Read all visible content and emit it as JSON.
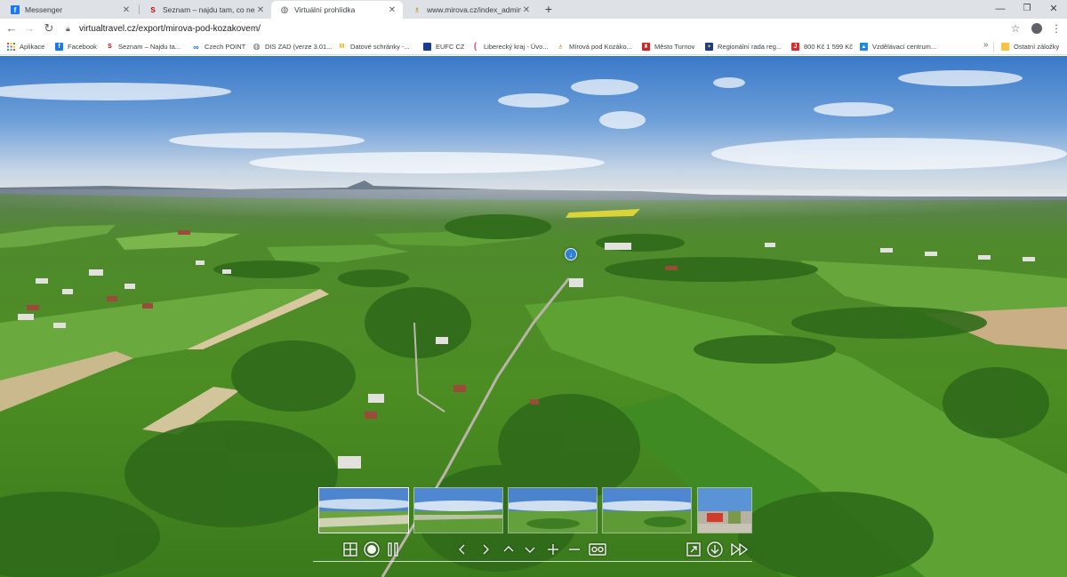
{
  "browser": {
    "tabs": [
      {
        "title": "Messenger",
        "icon": "facebook-icon",
        "color": "#1877f2",
        "glyph": "f"
      },
      {
        "title": "Seznam – najdu tam, co neznám",
        "icon": "seznam-icon",
        "color": "#cc0000",
        "glyph": "S"
      },
      {
        "title": "Virtuální prohlídka",
        "icon": "globe-icon",
        "color": "#5f6368",
        "glyph": "◍"
      },
      {
        "title": "www.mirova.cz/index_admin.php",
        "icon": "mirova-icon",
        "color": "#b8860b",
        "glyph": "♗"
      }
    ],
    "active_tab": 2,
    "url": "virtualtravel.cz/export/mirova-pod-kozakovem/"
  },
  "bookmarks": {
    "items": [
      {
        "label": "Aplikace",
        "icon": "apps-grid-icon",
        "color": "#ea4335",
        "glyph": "⋮"
      },
      {
        "label": "Facebook",
        "icon": "facebook-icon",
        "color": "#1877f2",
        "glyph": "f"
      },
      {
        "label": "Seznam – Najdu ta...",
        "icon": "seznam-icon",
        "color": "#cc0000",
        "glyph": "S"
      },
      {
        "label": "Czech POINT",
        "icon": "czech-point-icon",
        "color": "#1a73e8",
        "glyph": "∞"
      },
      {
        "label": "DIS ZAD (verze 3.01...",
        "icon": "globe-icon",
        "color": "#5f6368",
        "glyph": "◍"
      },
      {
        "label": "Datové schránky -...",
        "icon": "datove-schranky-icon",
        "color": "#f4b400",
        "glyph": "M"
      },
      {
        "label": "EUFC CZ",
        "icon": "eufc-icon",
        "color": "#1a3d8f",
        "glyph": "■"
      },
      {
        "label": "Liberecký kraj - Úvo...",
        "icon": "liberecky-kraj-icon",
        "color": "#e0457b",
        "glyph": "\\"
      },
      {
        "label": "Mírová pod Kozáko...",
        "icon": "mirova-icon",
        "color": "#b8860b",
        "glyph": "♗"
      },
      {
        "label": "Město Turnov",
        "icon": "turnov-icon",
        "color": "#c62828",
        "glyph": "♜"
      },
      {
        "label": "Regionální rada reg...",
        "icon": "eu-flag-icon",
        "color": "#1a3d8f",
        "glyph": "✦"
      },
      {
        "label": "800 Kč 1 599 Kč",
        "icon": "shop-icon",
        "color": "#d32f2f",
        "glyph": "J"
      },
      {
        "label": "Vzdělávací centrum...",
        "icon": "vzdelavaci-centrum-icon",
        "color": "#1e88e5",
        "glyph": "▲"
      }
    ],
    "more": "»",
    "other_folder": "Ostatní záložky"
  },
  "viewer": {
    "hotspot_glyph": "↓",
    "thumbnails": [
      {
        "name": "scene-1",
        "selected": true
      },
      {
        "name": "scene-2",
        "selected": false
      },
      {
        "name": "scene-3",
        "selected": false
      },
      {
        "name": "scene-4",
        "selected": false
      },
      {
        "name": "scene-5",
        "selected": false
      }
    ]
  },
  "colors": {
    "tabstrip": "#dee1e6",
    "sky_top": "#3f7fd0",
    "sky_horizon": "#dfe6ec",
    "field_green": "#4f8f2a",
    "hotspot": "#2f7fd6"
  }
}
